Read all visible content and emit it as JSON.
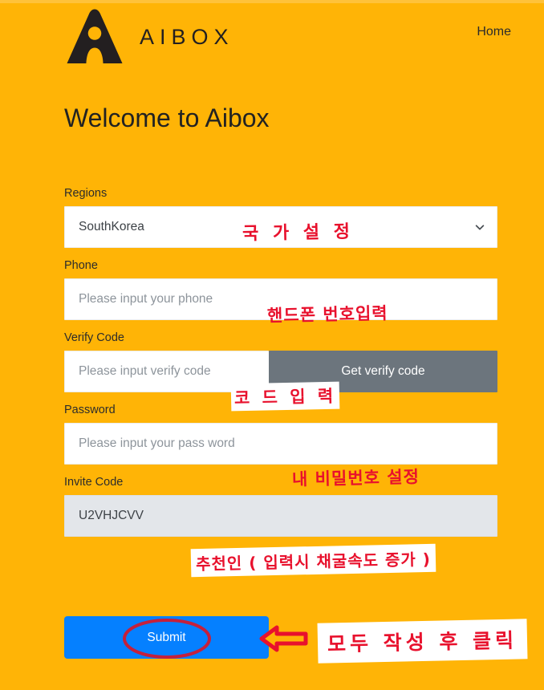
{
  "theme": {
    "background": "#FFB406",
    "field_background": "#FFFFFF",
    "field_disabled_background": "#E3E6EA",
    "secondary_button": "#6C757D",
    "primary_button": "#0580FF",
    "annotation_color": "#E8112D",
    "text_color": "#2c2c2c"
  },
  "header": {
    "logo_icon": "aibox-a-logo-icon",
    "brand": "AIBOX",
    "nav": {
      "home_label": "Home"
    }
  },
  "main": {
    "title": "Welcome to Aibox"
  },
  "form": {
    "regions": {
      "label": "Regions",
      "selected": "SouthKorea",
      "chevron_icon": "chevron-down-icon"
    },
    "phone": {
      "label": "Phone",
      "value": "",
      "placeholder": "Please input your phone"
    },
    "verify_code": {
      "label": "Verify Code",
      "value": "",
      "placeholder": "Please input verify code",
      "button_label": "Get verify code"
    },
    "password": {
      "label": "Password",
      "value": "",
      "placeholder": "Please input your pass word"
    },
    "invite_code": {
      "label": "Invite Code",
      "value": "U2VHJCVV",
      "placeholder": ""
    },
    "submit": {
      "label": "Submit"
    }
  },
  "annotations": {
    "regions": "국 가 설 정",
    "phone": "핸드폰 번호입력",
    "verify_code": "코 드 입 력",
    "password": "내 비밀번호 설정",
    "invite_code": "추천인 ( 입력시 채굴속도 증가 )",
    "submit": "모두 작성 후 클릭",
    "arrow_icon": "left-arrow-annotation-icon",
    "ellipse_icon": "ellipse-highlight-annotation-icon"
  }
}
